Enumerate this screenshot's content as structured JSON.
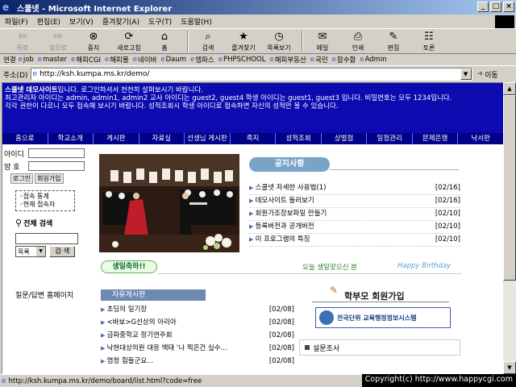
{
  "window": {
    "title": "스쿨넷 - Microsoft Internet Explorer"
  },
  "menu": [
    "파일(F)",
    "편집(E)",
    "보기(V)",
    "즐겨찾기(A)",
    "도구(T)",
    "도움말(H)"
  ],
  "toolbar": [
    {
      "label": "뒤로",
      "icon": "back-arrow-icon",
      "glyph": "⇦",
      "disabled": true
    },
    {
      "label": "앞으로",
      "icon": "forward-arrow-icon",
      "glyph": "⇨",
      "disabled": true
    },
    {
      "label": "중지",
      "icon": "stop-icon",
      "glyph": "⊗",
      "disabled": false
    },
    {
      "label": "새로고침",
      "icon": "refresh-icon",
      "glyph": "⟳",
      "disabled": false
    },
    {
      "label": "홈",
      "icon": "home-icon",
      "glyph": "⌂",
      "disabled": false
    },
    {
      "label": "검색",
      "icon": "search-icon",
      "glyph": "⌕",
      "disabled": false
    },
    {
      "label": "즐겨찾기",
      "icon": "favorites-icon",
      "glyph": "★",
      "disabled": false
    },
    {
      "label": "목록보기",
      "icon": "history-icon",
      "glyph": "◷",
      "disabled": false
    },
    {
      "label": "메일",
      "icon": "mail-icon",
      "glyph": "✉",
      "disabled": false
    },
    {
      "label": "인쇄",
      "icon": "print-icon",
      "glyph": "⎙",
      "disabled": false
    },
    {
      "label": "편집",
      "icon": "edit-icon",
      "glyph": "✎",
      "disabled": false
    },
    {
      "label": "토론",
      "icon": "discuss-icon",
      "glyph": "☷",
      "disabled": false
    }
  ],
  "links": {
    "label": "연결",
    "items": [
      "job",
      "master",
      "해피CGI",
      "해피몰",
      "네이버",
      "Daum",
      "엠파스",
      "PHPSCHOOL",
      "해피부동산",
      "국민",
      "잡수함",
      "Admin"
    ]
  },
  "address": {
    "label": "주소(D)",
    "url": "http://ksh.kumpa.ms.kr/demo/",
    "go": "이동"
  },
  "header": {
    "line1_a": "스쿨넷 데모사이트",
    "line1_b": "입니다. 로그인하셔서 천천히 살펴보시기 바랍니다.",
    "line2": "최고관리자 아이디는 admin, admin1, admin2 교사 아이디는 guest2, guest4 학생 아이디는 guest1, guest3 입니다. 비밀번호는 모두 1234입니다.",
    "line3": "각각 권한이 다르니 모두 접속해 보시기 바랍니다. 성적조회시 학생 아이디로 접속하면 자신의 성적만 볼 수 있습니다."
  },
  "nav": [
    "홈으로",
    "학교소개",
    "게시판",
    "자료실",
    "선생님 게시판",
    "족지",
    "성적조회",
    "상벌점",
    "일정관리",
    "문제은행",
    "낙서판"
  ],
  "login": {
    "id_label": "아이디",
    "pw_label": "암 호",
    "login_btn": "로그인",
    "join_btn": "회원가입",
    "stat1": "◦접속 통계",
    "stat2": "◦현재 접속자"
  },
  "search": {
    "title": "전체 검색",
    "select": "목록",
    "button": "검 색"
  },
  "qa": "질문/답변 홈페이지",
  "notice": {
    "title": "공지사항",
    "items": [
      {
        "title": "스쿨넷 자세한 사용법(1)",
        "date": "[02/16]"
      },
      {
        "title": "데모사이트 둘러보기",
        "date": "[02/16]"
      },
      {
        "title": "회원가조장보파일 만들기",
        "date": "[02/10]"
      },
      {
        "title": "등록버전과 공개버전",
        "date": "[02/10]"
      },
      {
        "title": "이 프로그램의 특징",
        "date": "[02/10]"
      }
    ]
  },
  "birthday": {
    "tag": "생일축하!!",
    "msg": "오늘 생일맞으신 분",
    "en": "Happy Birthday"
  },
  "board": {
    "title": "자유게시판",
    "items": [
      {
        "title": "초딩의 일기장",
        "date": "[02/08]"
      },
      {
        "title": "<바보>G선상의 아리아",
        "date": "[02/08]"
      },
      {
        "title": "금파중학교 정기연주회",
        "date": "[02/08]"
      },
      {
        "title": "낙현대상의원 대응 백태 '나 찍은건 실수...",
        "date": "[02/08]"
      },
      {
        "title": "염청 힘들군요...",
        "date": "[02/08]"
      }
    ]
  },
  "parent": "학부모 회원가입",
  "gov": "전국단위 교육행정정보시스템",
  "survey": "설문조사",
  "status": {
    "text": "http://ksh.kumpa.ms.kr/demo/board/list.html?code=free"
  },
  "copyright": "Copyright(c) http://www.happycgi.com"
}
